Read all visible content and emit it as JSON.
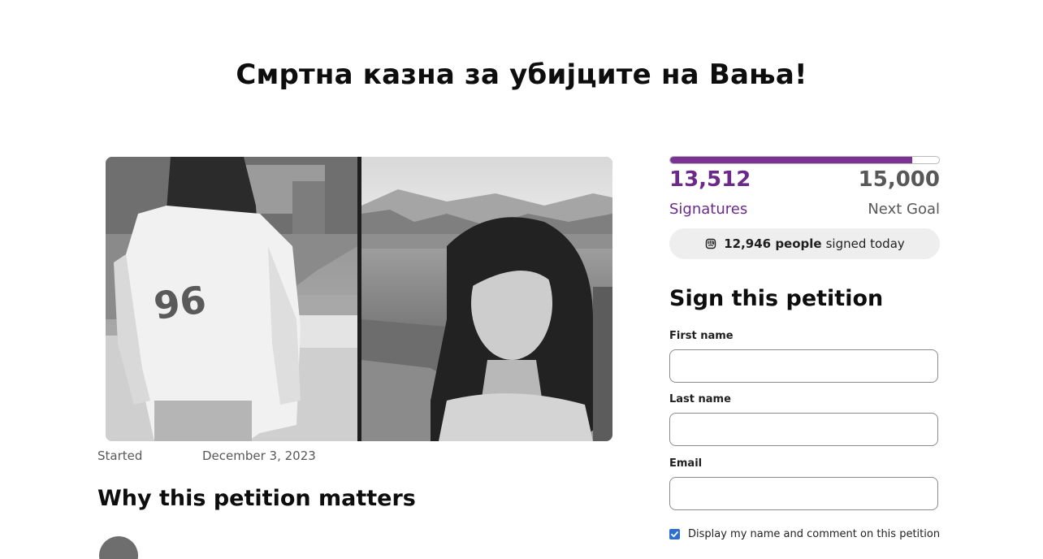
{
  "petition": {
    "title": "Смртна казна за убијците на Вања!",
    "started_label": "Started",
    "started_date": "December 3, 2023",
    "why_heading": "Why this petition matters"
  },
  "signatures": {
    "count": "13,512",
    "count_label": "Signatures",
    "goal": "15,000",
    "goal_label": "Next Goal",
    "progress_fraction": 0.9008,
    "today_count": "12,946 people",
    "today_suffix": "signed today"
  },
  "sign_form": {
    "heading": "Sign this petition",
    "first_name_label": "First name",
    "first_name_value": "",
    "last_name_label": "Last name",
    "last_name_value": "",
    "email_label": "Email",
    "email_value": "",
    "consent_label": "Display my name and comment on this petition",
    "consent_checked": true
  },
  "colors": {
    "accent": "#7b3294",
    "accent_text": "#6b2a8a",
    "checkbox": "#2d6fd0",
    "pill_bg": "#eeeeee"
  },
  "icons": {
    "today_icon": "raised-fist-icon",
    "consent_icon": "checkmark-icon"
  }
}
